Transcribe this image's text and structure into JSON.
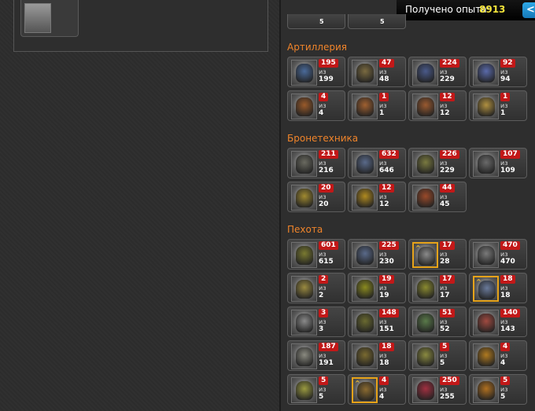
{
  "topbar": {
    "experience_label": "Получено опыта:",
    "experience_value": "8913",
    "arrow": "<"
  },
  "of_word": "из",
  "sections": [
    {
      "title": "Артиллерия",
      "units": [
        {
          "count": "195",
          "total": "199",
          "color": "#4a6a9a"
        },
        {
          "count": "47",
          "total": "48",
          "color": "#7a6a40"
        },
        {
          "count": "224",
          "total": "229",
          "color": "#4a5a8a"
        },
        {
          "count": "92",
          "total": "94",
          "color": "#5a6aaa"
        },
        {
          "count": "4",
          "total": "4",
          "color": "#9a5a2a"
        },
        {
          "count": "1",
          "total": "1",
          "color": "#a06030"
        },
        {
          "count": "12",
          "total": "12",
          "color": "#9a5a30"
        },
        {
          "count": "1",
          "total": "1",
          "color": "#b09040"
        }
      ]
    },
    {
      "title": "Бронетехника",
      "units": [
        {
          "count": "211",
          "total": "216",
          "color": "#6a6a60"
        },
        {
          "count": "632",
          "total": "646",
          "color": "#5a6a8a"
        },
        {
          "count": "226",
          "total": "229",
          "color": "#7a7a40"
        },
        {
          "count": "107",
          "total": "109",
          "color": "#6a6a6a"
        },
        {
          "count": "20",
          "total": "20",
          "color": "#a08a30"
        },
        {
          "count": "12",
          "total": "12",
          "color": "#b08a20"
        },
        {
          "count": "44",
          "total": "45",
          "color": "#9a4a2a"
        }
      ]
    },
    {
      "title": "Пехота",
      "units": [
        {
          "count": "601",
          "total": "615",
          "color": "#7a7a30"
        },
        {
          "count": "225",
          "total": "230",
          "color": "#5a6a8a"
        },
        {
          "count": "17",
          "total": "28",
          "color": "#8a8a8a",
          "gold": true,
          "rank": "^"
        },
        {
          "count": "470",
          "total": "470",
          "color": "#7a7a7a"
        },
        {
          "count": "2",
          "total": "2",
          "color": "#9a8a40"
        },
        {
          "count": "19",
          "total": "19",
          "color": "#8a8a20"
        },
        {
          "count": "17",
          "total": "17",
          "color": "#8a8a30"
        },
        {
          "count": "18",
          "total": "18",
          "color": "#6a7a9a",
          "gold": true,
          "rank": "^"
        },
        {
          "count": "3",
          "total": "3",
          "color": "#8a8a8a"
        },
        {
          "count": "148",
          "total": "151",
          "color": "#6a6a30"
        },
        {
          "count": "51",
          "total": "52",
          "color": "#5a7a4a"
        },
        {
          "count": "140",
          "total": "143",
          "color": "#a04a40"
        },
        {
          "count": "187",
          "total": "191",
          "color": "#8a8a80"
        },
        {
          "count": "18",
          "total": "18",
          "color": "#7a6a30"
        },
        {
          "count": "5",
          "total": "5",
          "color": "#8a8a40"
        },
        {
          "count": "4",
          "total": "4",
          "color": "#b07a20"
        },
        {
          "count": "5",
          "total": "5",
          "color": "#9a9a40"
        },
        {
          "count": "4",
          "total": "4",
          "color": "#8a6a30",
          "gold": true,
          "rank": "^"
        },
        {
          "count": "250",
          "total": "255",
          "color": "#a03040"
        },
        {
          "count": "5",
          "total": "5",
          "color": "#b07020"
        }
      ]
    }
  ],
  "top_partial": [
    {
      "total_fragment": "5"
    },
    {
      "total_fragment": "5"
    }
  ]
}
